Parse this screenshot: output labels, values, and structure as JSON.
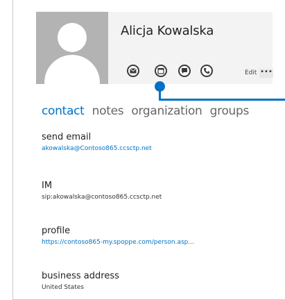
{
  "contact": {
    "name": "Alicja Kowalska",
    "actions": [
      {
        "name": "email-icon"
      },
      {
        "name": "calendar-icon"
      },
      {
        "name": "chat-icon"
      },
      {
        "name": "phone-icon"
      }
    ],
    "edit_label": "Edit",
    "more_label": "•••"
  },
  "tabs": [
    {
      "label": "contact",
      "active": true
    },
    {
      "label": "notes",
      "active": false
    },
    {
      "label": "organization",
      "active": false
    },
    {
      "label": "groups",
      "active": false
    }
  ],
  "sections": [
    {
      "label": "send email",
      "value": "akowalska@Contoso865.ccsctp.net"
    },
    {
      "label": "IM",
      "value": "sip:akowalska@contoso865.ccsctp.net"
    },
    {
      "label": "profile",
      "value": "https://contoso865-my.spoppe.com/person.asp..."
    },
    {
      "label": "business address",
      "value": "United States"
    }
  ],
  "colors": {
    "accent": "#0072c6",
    "avatar_bg": "#b3b3b3",
    "header_bg": "#f3f3f3"
  }
}
